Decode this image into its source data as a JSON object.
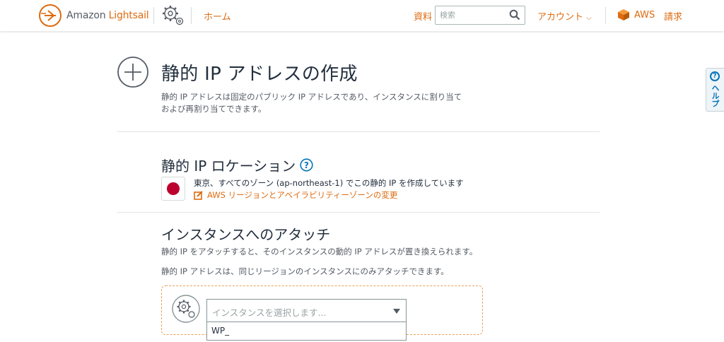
{
  "header": {
    "brand_prefix": "Amazon",
    "brand_name": "Lightsail",
    "home": "ホーム",
    "docs": "資料",
    "search_placeholder": "検索",
    "search_value": "",
    "account": "アカウント",
    "aws": "AWS",
    "billing": "請求"
  },
  "help": {
    "label": "ヘルプ"
  },
  "page": {
    "title": "静的 IP アドレスの作成",
    "description": "静的 IP アドレスは固定のパブリック IP アドレスであり、インスタンスに割り当ておよび再割り当てできます。"
  },
  "location": {
    "title": "静的 IP ロケーション",
    "text": "東京、すべてのゾーン (ap-northeast-1) でこの静的 IP を作成しています",
    "change_link": "AWS リージョンとアベイラビリティーゾーンの変更"
  },
  "attach": {
    "title": "インスタンスへのアタッチ",
    "desc1": "静的 IP をアタッチすると、そのインスタンスの動的 IP アドレスが置き換えられます。",
    "desc2": "静的 IP アドレスは、同じリージョンのインスタンスにのみアタッチできます。",
    "select_placeholder": "インスタンスを選択します...",
    "options": [
      "WP_"
    ]
  },
  "colors": {
    "accent": "#dd6b10",
    "link_blue": "#0073bb",
    "text": "#232f3e",
    "flag_red": "#bc002d"
  }
}
